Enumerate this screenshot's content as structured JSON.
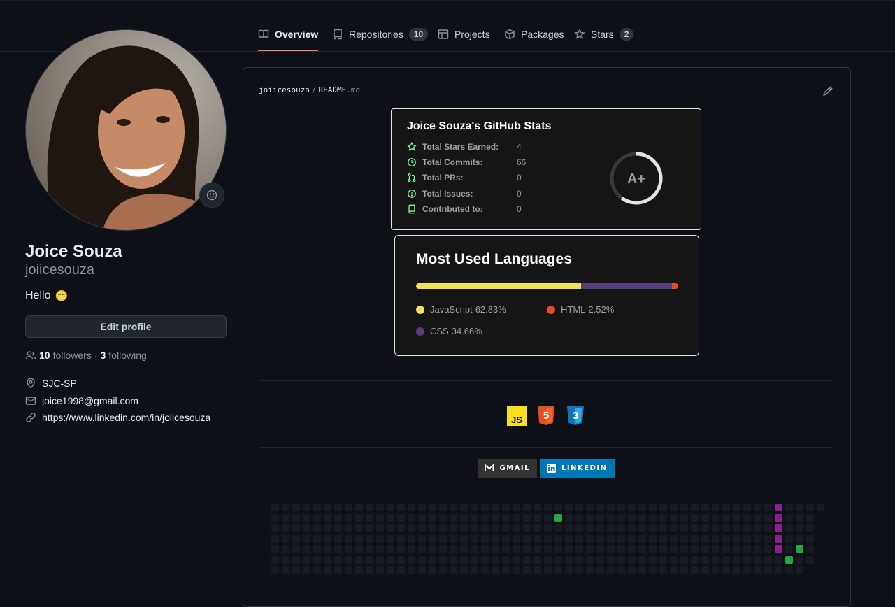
{
  "tabs": [
    {
      "label": "Overview",
      "icon": "book-icon",
      "active": true
    },
    {
      "label": "Repositories",
      "icon": "repo-icon",
      "count": "10"
    },
    {
      "label": "Projects",
      "icon": "table-icon"
    },
    {
      "label": "Packages",
      "icon": "package-icon"
    },
    {
      "label": "Stars",
      "icon": "star-icon",
      "count": "2"
    }
  ],
  "profile": {
    "name": "Joice Souza",
    "login": "joiicesouza",
    "bio": "Hello",
    "bio_emoji": "😁",
    "edit_label": "Edit profile",
    "followers_count": "10",
    "followers_label": "followers",
    "separator": "·",
    "following_count": "3",
    "following_label": "following",
    "location": "SJC-SP",
    "email": "joice1998@gmail.com",
    "website": "https://www.linkedin.com/in/joiicesouza"
  },
  "readme": {
    "owner": "joiicesouza",
    "sep": "/",
    "file": "README",
    "ext": ".md"
  },
  "stats_card": {
    "title": "Joice Souza's GitHub Stats",
    "rows": [
      {
        "label": "Total Stars Earned:",
        "value": "4",
        "icon": "star-icon"
      },
      {
        "label": "Total Commits:",
        "value": "66",
        "icon": "history-icon"
      },
      {
        "label": "Total PRs:",
        "value": "0",
        "icon": "pull-request-icon"
      },
      {
        "label": "Total Issues:",
        "value": "0",
        "icon": "issue-icon"
      },
      {
        "label": "Contributed to:",
        "value": "0",
        "icon": "repo-icon"
      }
    ],
    "rank": "A+",
    "rank_progress": 0.6,
    "accent": "#79ff97"
  },
  "langs_card": {
    "title": "Most Used Languages",
    "languages": [
      {
        "name": "JavaScript",
        "percent": "62.83%",
        "value": 62.83,
        "color": "#f1e05a"
      },
      {
        "name": "HTML",
        "percent": "2.52%",
        "value": 2.52,
        "color": "#e34c26"
      },
      {
        "name": "CSS",
        "percent": "34.66%",
        "value": 34.66,
        "color": "#563d7c"
      }
    ],
    "bar_order": [
      "JavaScript",
      "CSS",
      "HTML"
    ]
  },
  "tech_icons": [
    {
      "name": "javascript-icon",
      "text": "JS",
      "color": "#f7df1e"
    },
    {
      "name": "html5-icon",
      "text": "5",
      "color": "#e34f26"
    },
    {
      "name": "css3-icon",
      "text": "3",
      "color": "#1572b6"
    }
  ],
  "badges": [
    {
      "name": "gmail-badge",
      "label": "GMAIL",
      "color": "#333333"
    },
    {
      "name": "linkedin-badge",
      "label": "LINKEDIN",
      "color": "#0077b5"
    }
  ],
  "colors": {
    "background": "#0d1117",
    "tab_underline": "#f78166",
    "contrib_empty": "#161b22",
    "contrib_green": "#26a641",
    "contrib_purple": "#8b1f8b"
  }
}
